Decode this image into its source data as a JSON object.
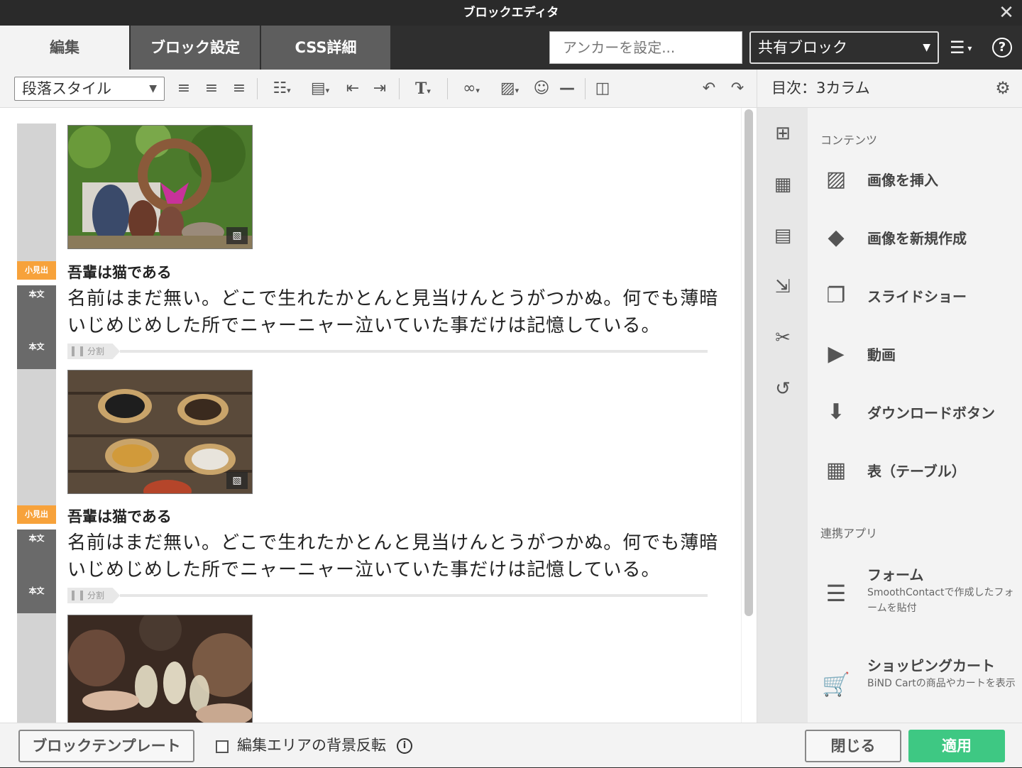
{
  "window": {
    "title": "ブロックエディタ"
  },
  "tabs": [
    "編集",
    "ブロック設定",
    "CSS詳細"
  ],
  "anchor": {
    "placeholder": "アンカーを設定..."
  },
  "shared_block": {
    "selected": "共有ブロック"
  },
  "toolbar": {
    "paragraph_style": "段落スタイル"
  },
  "right_panel": {
    "title": "目次：3カラム",
    "section_contents": "コンテンツ",
    "items": [
      "画像を挿入",
      "画像を新規作成",
      "スライドショー",
      "動画",
      "ダウンロードボタン",
      "表（テーブル）"
    ],
    "section_apps": "連携アプリ",
    "apps": [
      {
        "label": "フォーム",
        "desc": "SmoothContactで作成したフォームを貼付"
      },
      {
        "label": "ショッピングカート",
        "desc": "BiND Cartの商品やカートを表示"
      }
    ]
  },
  "editor": {
    "tag_heading": "小見出",
    "tag_body": "本文",
    "split_label": "分割",
    "blocks": [
      {
        "heading": "吾輩は猫である",
        "body": "名前はまだ無い。どこで生れたかとんと見当けんとうがつかぬ。何でも薄暗いじめじめした所でニャーニャー泣いていた事だけは記憶している。"
      },
      {
        "heading": "吾輩は猫である",
        "body": "名前はまだ無い。どこで生れたかとんと見当けんとうがつかぬ。何でも薄暗いじめじめした所でニャーニャー泣いていた事だけは記憶している。"
      }
    ]
  },
  "footer": {
    "template_button": "ブロックテンプレート",
    "invert_bg_label": "編集エリアの背景反転",
    "close_button": "閉じる",
    "apply_button": "適用"
  },
  "colors": {
    "accent_green": "#3ec883",
    "tag_orange": "#f7a23b"
  }
}
